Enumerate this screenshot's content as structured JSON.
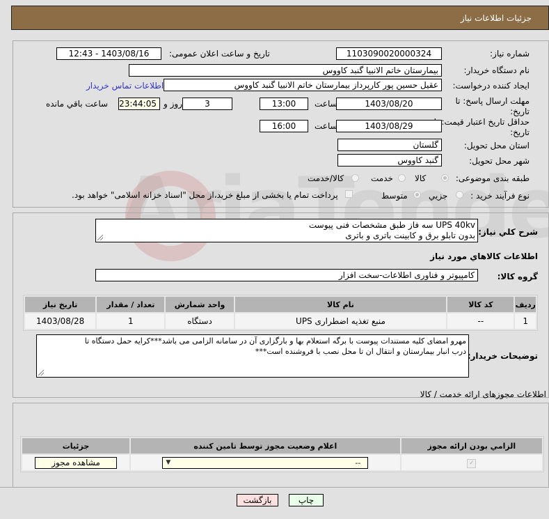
{
  "header": {
    "title": "جزئیات اطلاعات نیاز"
  },
  "form": {
    "need_number": {
      "label": "شماره نیاز:",
      "value": "1103090020000324"
    },
    "announce_datetime": {
      "label": "تاریخ و ساعت اعلان عمومی:",
      "value": "1403/08/16 - 12:43"
    },
    "buyer_org": {
      "label": "نام دستگاه خریدار:",
      "value": "بیمارستان خاتم الانبیا گنبد کاووس"
    },
    "requester": {
      "label": "ایجاد کننده درخواست:",
      "value": "عقیل حسین پور کارپرداز بیمارستان خاتم الانبیا گنبد کاووس"
    },
    "buyer_contact_link": "اطلاعات تماس خریدار",
    "reply_deadline": {
      "label": "مهلت ارسال پاسخ: تا تاریخ:",
      "date": "1403/08/20",
      "time_label": "ساعت",
      "time": "13:00",
      "days": "3",
      "days_label": "روز و",
      "remaining": "23:44:05",
      "remaining_label": "ساعت باقي مانده"
    },
    "price_validity": {
      "label": "حداقل تاریخ اعتبار قیمت: تا تاریخ:",
      "date": "1403/08/29",
      "time_label": "ساعت",
      "time": "16:00"
    },
    "province": {
      "label": "استان محل تحویل:",
      "value": "گلستان"
    },
    "city": {
      "label": "شهر محل تحویل:",
      "value": "گنبد کاووس"
    },
    "category": {
      "label": "طبقه بندی موضوعی:",
      "options": [
        "کالا",
        "خدمت",
        "کالا/خدمت"
      ],
      "selected": "کالا"
    },
    "purchase_type": {
      "label": "نوع فرآیند خرید :",
      "options": [
        "جزیي",
        "متوسط"
      ],
      "selected": "متوسط",
      "treasury_checkbox_label": "پرداخت تمام یا بخشی از مبلغ خرید،از محل \"اسناد خزانه اسلامی\" خواهد بود."
    }
  },
  "description": {
    "label": "شرح کلي نياز:",
    "line1": "UPS 40kv  سه فاز طبق مشخصات فنی پیوست",
    "line2": "بدون تابلو برق و کابینت باتری و باتری"
  },
  "goods_section": {
    "title": "اطلاعات کالاهاي مورد نياز",
    "group_label": "گروه کالا:",
    "group_value": "کامپیوتر و فناوری اطلاعات-سخت افزار",
    "columns": [
      "رديف",
      "کد کالا",
      "نام کالا",
      "واحد شمارش",
      "تعداد / مقدار",
      "تاریخ نیاز"
    ],
    "rows": [
      {
        "index": "1",
        "code": "--",
        "name": "منبع تغذیه اضطراری UPS",
        "unit": "دستگاه",
        "qty": "1",
        "date": "1403/08/28"
      }
    ]
  },
  "buyer_notes": {
    "label": "توضیحات خریدار:",
    "line1": "مهرو امضای کلیه مستندات پیوست با برگه استعلام بها و  بارگزاری آن در سامانه الزامی می باشد***کرایه حمل دستگاه تا",
    "line2": "درب انبار بیمارستان و انتقال ان تا محل نصب با فروشنده است***"
  },
  "permits": {
    "title": "اطلاعات مجوزهای ارائه خدمت / کالا",
    "columns": [
      "الزامي بودن ارائه مجوز",
      "اعلام وضعیت مجوز توسط تامین کننده",
      "جزئیات"
    ],
    "row": {
      "required_checked": true,
      "status_select": "--",
      "details_button": "مشاهده مجوز"
    }
  },
  "buttons": {
    "print": "چاپ",
    "back": "بازگشت"
  },
  "colors": {
    "header_bg": "#8c6d46",
    "print_bg": "#eaffea",
    "back_bg": "#ffe0e0",
    "link": "#3333cc"
  }
}
